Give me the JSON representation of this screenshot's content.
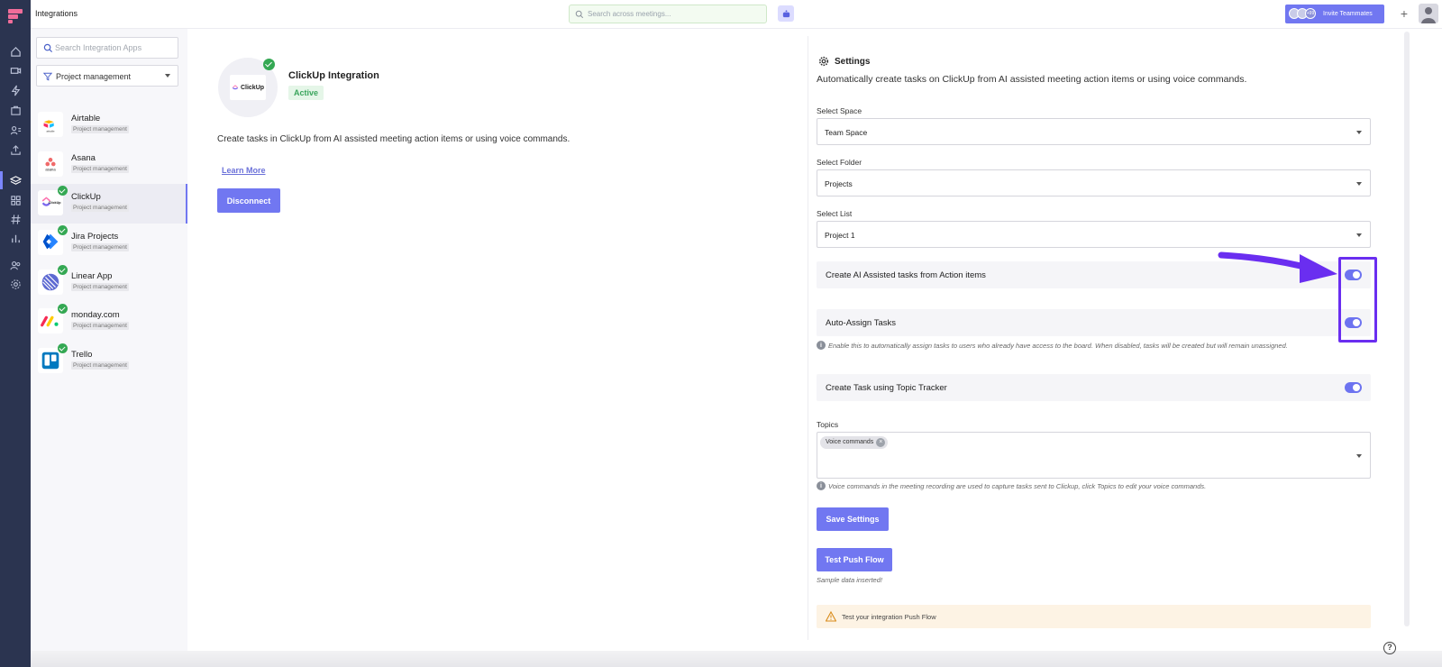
{
  "topbar": {
    "title": "Integrations",
    "search_placeholder": "Search across meetings...",
    "invite_label": "Invite Teammates",
    "invite_count": "+99",
    "plus": "+"
  },
  "sidebar": {
    "search_placeholder": "Search Integration Apps",
    "filter_value": "Project management",
    "apps": [
      {
        "name": "Airtable",
        "category": "Project management",
        "connected": false
      },
      {
        "name": "Asana",
        "category": "Project management",
        "connected": false
      },
      {
        "name": "ClickUp",
        "category": "Project management",
        "connected": true,
        "selected": true
      },
      {
        "name": "Jira Projects",
        "category": "Project management",
        "connected": true
      },
      {
        "name": "Linear App",
        "category": "Project management",
        "connected": true
      },
      {
        "name": "monday.com",
        "category": "Project management",
        "connected": true
      },
      {
        "name": "Trello",
        "category": "Project management",
        "connected": true
      }
    ]
  },
  "detail": {
    "logo_text": "ClickUp",
    "title": "ClickUp Integration",
    "status": "Active",
    "description": "Create tasks in ClickUp from AI assisted meeting action items or using voice commands.",
    "learn_more": "Learn More",
    "disconnect": "Disconnect"
  },
  "settings": {
    "heading": "Settings",
    "subtitle": "Automatically create tasks on ClickUp from AI assisted meeting action items or using voice commands.",
    "space": {
      "label": "Select Space",
      "value": "Team Space"
    },
    "folder": {
      "label": "Select Folder",
      "value": "Projects"
    },
    "list": {
      "label": "Select List",
      "value": "Project 1"
    },
    "toggles": {
      "ai_tasks": {
        "label": "Create AI Assisted tasks from Action items",
        "on": true
      },
      "auto_assign": {
        "label": "Auto-Assign Tasks",
        "on": true
      },
      "topic_tracker": {
        "label": "Create Task using Topic Tracker",
        "on": true
      }
    },
    "auto_assign_hint": "Enable this to automatically assign tasks to users who already have access to the board. When disabled, tasks will be created but will remain unassigned.",
    "topics_label": "Topics",
    "topics": [
      "Voice commands"
    ],
    "topics_hint": "Voice commands in the meeting recording are used to capture tasks sent to Clickup, click Topics to edit your voice commands.",
    "save_button": "Save Settings",
    "test_button": "Test Push Flow",
    "sample_note": "Sample data inserted!",
    "warning": "Test your integration Push Flow"
  },
  "colors": {
    "accent": "#7177f1",
    "rail": "#2b3450",
    "success": "#34a853",
    "annotation": "#6a2ef0"
  },
  "help": "?"
}
